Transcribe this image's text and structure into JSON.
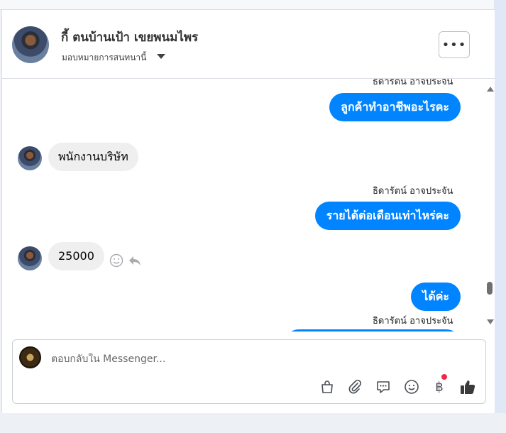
{
  "header": {
    "name": "กี้ ตนบ้านเป้า เขยพนมไพร",
    "assign_label": "มอบหมายการสนทนานี้",
    "more_label": "•••"
  },
  "thread": {
    "messages": [
      {
        "type": "label",
        "text": "ธิดารัตน์ อาจประจัน"
      },
      {
        "type": "out",
        "text": "ลูกค้าทำอาชีพอะไรคะ"
      },
      {
        "type": "in",
        "text": "พนักงานบริษัท"
      },
      {
        "type": "label",
        "text": "ธิดารัตน์ อาจประจัน"
      },
      {
        "type": "out",
        "text": "รายได้ต่อเดือนเท่าไหร่คะ"
      },
      {
        "type": "in",
        "text": "25000"
      },
      {
        "type": "out",
        "text": "ได้ค่ะ"
      },
      {
        "type": "label",
        "text": "ธิดารัตน์ อาจประจัน"
      }
    ]
  },
  "composer": {
    "placeholder": "ตอบกลับใน Messenger...",
    "baht_symbol": "฿"
  },
  "colors": {
    "accent": "#0084ff",
    "incoming_bubble": "#efefef",
    "notification_dot": "#f02849"
  }
}
